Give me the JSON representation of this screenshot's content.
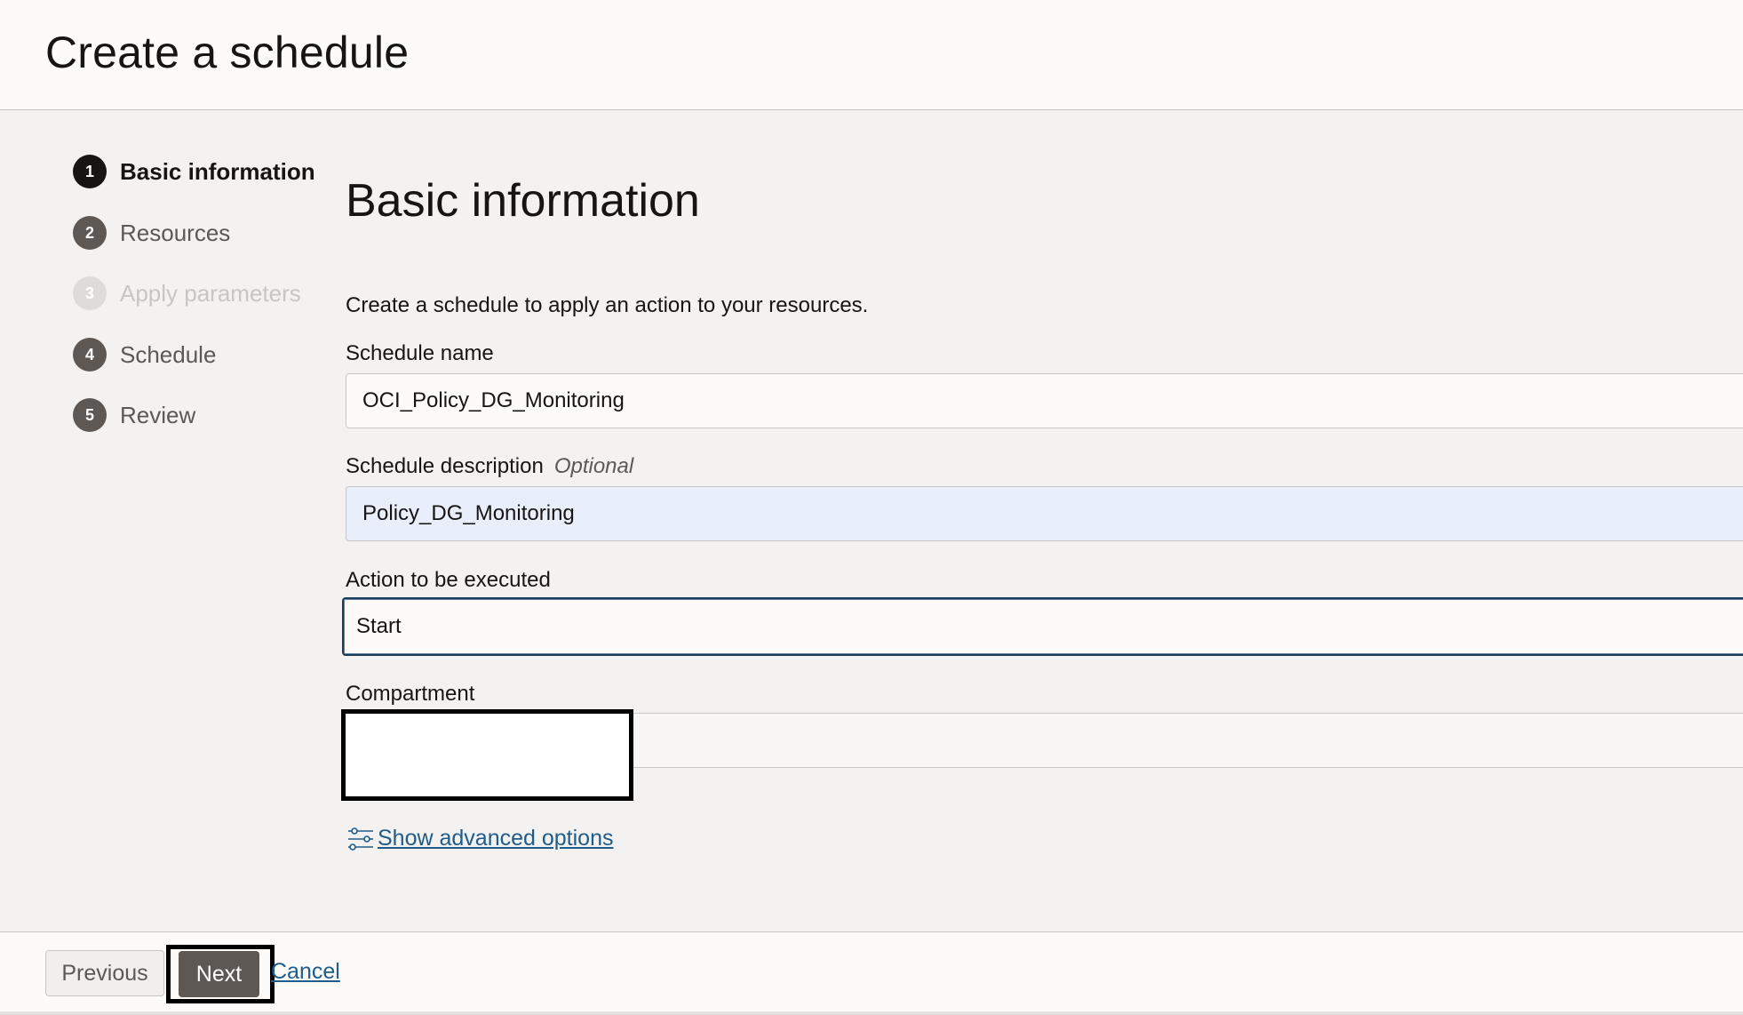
{
  "header": {
    "title": "Create a schedule"
  },
  "steps": [
    {
      "number": "1",
      "label": "Basic information",
      "state": "active"
    },
    {
      "number": "2",
      "label": "Resources",
      "state": "enabled"
    },
    {
      "number": "3",
      "label": "Apply parameters",
      "state": "disabled"
    },
    {
      "number": "4",
      "label": "Schedule",
      "state": "enabled"
    },
    {
      "number": "5",
      "label": "Review",
      "state": "enabled"
    }
  ],
  "main": {
    "section_title": "Basic information",
    "intro": "Create a schedule to apply an action to your resources.",
    "schedule_name": {
      "label": "Schedule name",
      "value": "OCI_Policy_DG_Monitoring"
    },
    "schedule_description": {
      "label": "Schedule description",
      "optional": "Optional",
      "value": "Policy_DG_Monitoring"
    },
    "action": {
      "label": "Action to be executed",
      "value": "Start"
    },
    "compartment": {
      "label": "Compartment",
      "value": ""
    },
    "advanced_options": {
      "label": "Show advanced options",
      "icon": "sliders-icon"
    }
  },
  "footer": {
    "previous_label": "Previous",
    "next_label": "Next",
    "cancel_label": "Cancel"
  },
  "colors": {
    "accent_link": "#1f5c8b",
    "step_active": "#161513",
    "step_default": "#5d5854",
    "step_disabled": "#dedcd9",
    "autofill_bg": "#e8effb",
    "focus_border": "#1a3d5c"
  }
}
